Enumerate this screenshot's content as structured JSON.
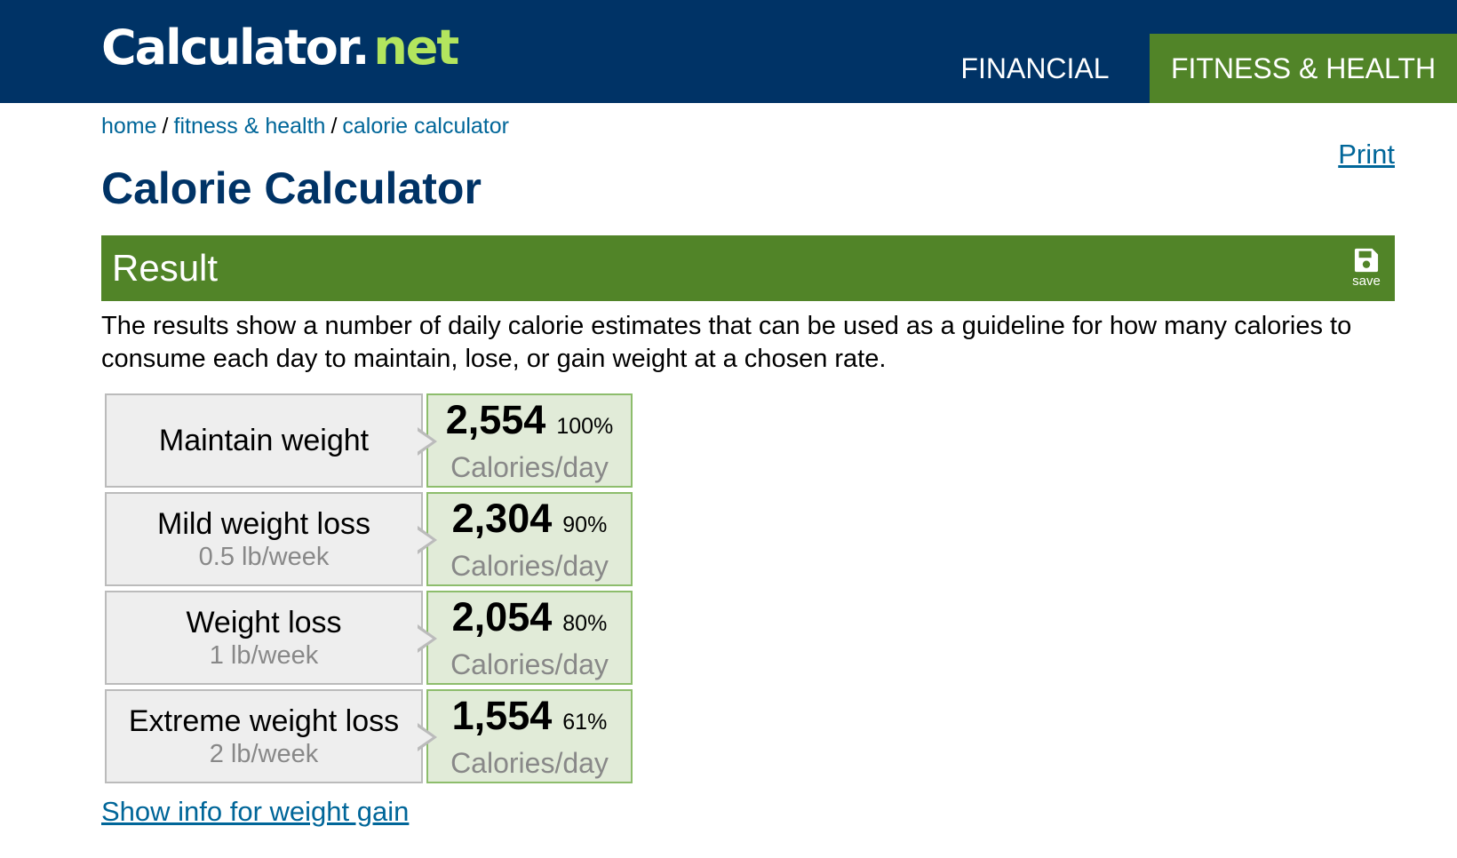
{
  "header": {
    "logo_main": "Calculator.",
    "logo_accent": "net",
    "nav": [
      {
        "label": "FINANCIAL"
      },
      {
        "label": "FITNESS & HEALTH"
      }
    ]
  },
  "breadcrumb": {
    "home": "home",
    "sep1": "/",
    "section": "fitness & health",
    "sep2": "/",
    "current": "calorie calculator"
  },
  "print_label": "Print",
  "page_title": "Calorie Calculator",
  "result": {
    "title": "Result",
    "save_label": "save",
    "save_icon": "floppy-disk-icon"
  },
  "description": "The results show a number of daily calorie estimates that can be used as a guideline for how many calories to consume each day to maintain, lose, or gain weight at a chosen rate.",
  "rows": [
    {
      "label": "Maintain weight",
      "sub": "",
      "calories": "2,554",
      "percent": "100%",
      "unit": "Calories/day"
    },
    {
      "label": "Mild weight loss",
      "sub": "0.5 lb/week",
      "calories": "2,304",
      "percent": "90%",
      "unit": "Calories/day"
    },
    {
      "label": "Weight loss",
      "sub": "1 lb/week",
      "calories": "2,054",
      "percent": "80%",
      "unit": "Calories/day"
    },
    {
      "label": "Extreme weight loss",
      "sub": "2 lb/week",
      "calories": "1,554",
      "percent": "61%",
      "unit": "Calories/day"
    }
  ],
  "gain_link": "Show info for weight gain",
  "colors": {
    "header_bg": "#003366",
    "accent_green": "#518428",
    "logo_green": "#b3e55e",
    "link_blue": "#006699",
    "value_bg": "#e1ebd8"
  }
}
